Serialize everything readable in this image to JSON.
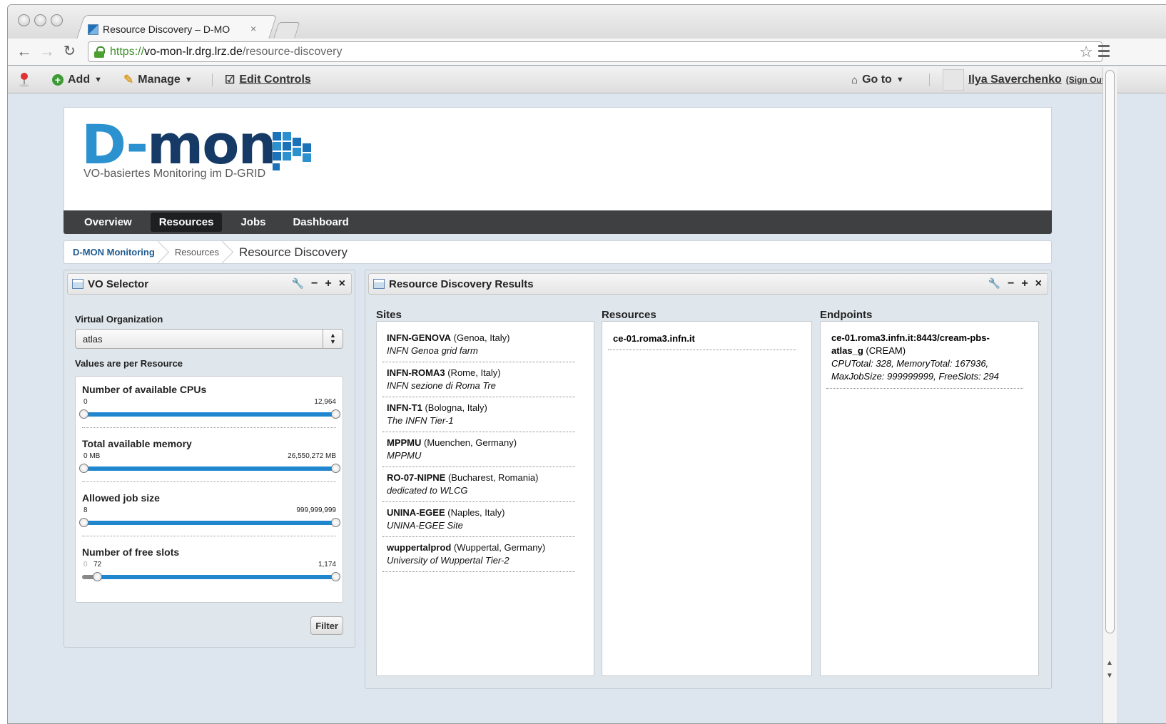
{
  "browser": {
    "tab_title": "Resource Discovery – D-MO",
    "tab_close": "×",
    "url_proto": "https://",
    "url_host": "vo-mon-lr.drg.lrz.de",
    "url_path": "/resource-discovery"
  },
  "plone_toolbar": {
    "add": "Add",
    "manage": "Manage",
    "edit_controls": "Edit Controls",
    "goto": "Go to",
    "user": "Ilya Saverchenko",
    "signout": "(Sign Out)"
  },
  "logo": {
    "part1": "D-",
    "part2": "mon",
    "subtitle": "VO-basiertes Monitoring im D-GRID",
    "colors": {
      "light": "#2b91cf",
      "dark": "#153a66"
    }
  },
  "nav": {
    "items": [
      {
        "label": "Overview"
      },
      {
        "label": "Resources",
        "active": true
      },
      {
        "label": "Jobs"
      },
      {
        "label": "Dashboard"
      }
    ]
  },
  "breadcrumbs": [
    "D-MON Monitoring",
    "Resources",
    "Resource Discovery"
  ],
  "vo_selector": {
    "title": "VO Selector",
    "vo_label": "Virtual Organization",
    "vo_value": "atlas",
    "values_label": "Values are per Resource",
    "filters": [
      {
        "title": "Number of available CPUs",
        "min": "0",
        "max": "12,964"
      },
      {
        "title": "Total available memory",
        "min": "0 MB",
        "max": "26,550,272 MB"
      },
      {
        "title": "Allowed job size",
        "min": "8",
        "max": "999,999,999"
      },
      {
        "title": "Number of free slots",
        "min_zero": "0",
        "min": "72",
        "max": "1,174"
      }
    ],
    "filter_button": "Filter"
  },
  "results": {
    "title": "Resource Discovery Results",
    "sites_title": "Sites",
    "resources_title": "Resources",
    "endpoints_title": "Endpoints",
    "sites": [
      {
        "name": "INFN-GENOVA",
        "loc": " (Genoa, Italy)",
        "desc": "INFN Genoa grid farm"
      },
      {
        "name": "INFN-ROMA3",
        "loc": " (Rome, Italy)",
        "desc": "INFN sezione di Roma Tre"
      },
      {
        "name": "INFN-T1",
        "loc": " (Bologna, Italy)",
        "desc": "The INFN Tier-1"
      },
      {
        "name": "MPPMU",
        "loc": " (Muenchen, Germany)",
        "desc": "MPPMU"
      },
      {
        "name": "RO-07-NIPNE",
        "loc": " (Bucharest, Romania)",
        "desc": "dedicated to WLCG"
      },
      {
        "name": "UNINA-EGEE",
        "loc": " (Naples, Italy)",
        "desc": "UNINA-EGEE Site"
      },
      {
        "name": "wuppertalprod",
        "loc": " (Wuppertal, Germany)",
        "desc": "University of Wuppertal Tier-2"
      }
    ],
    "resources": [
      "ce-01.roma3.infn.it"
    ],
    "endpoint": {
      "name_line1": "ce-01.roma3.infn.it:8443/cream-pbs-",
      "name_line2": "atlas_g",
      "type": " (CREAM)",
      "details_line1": "CPUTotal: 328, MemoryTotal: 167936,",
      "details_line2": "MaxJobSize: 999999999, FreeSlots: 294"
    }
  }
}
